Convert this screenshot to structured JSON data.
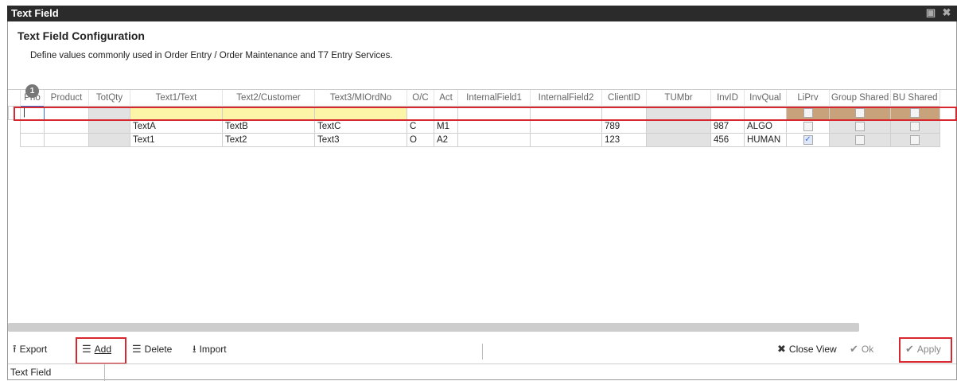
{
  "window": {
    "title": "Text Field",
    "icons": [
      "restore-icon",
      "close-icon"
    ]
  },
  "config": {
    "title": "Text Field Configuration",
    "description": "Define values commonly used in Order Entry / Order Maintenance and T7 Entry Services."
  },
  "grid": {
    "badge_count": "1",
    "columns": [
      "Prio",
      "Product",
      "TotQty",
      "Text1/Text",
      "Text2/Customer",
      "Text3/MIOrdNo",
      "O/C",
      "Act",
      "InternalField1",
      "InternalField2",
      "ClientID",
      "TUMbr",
      "InvID",
      "InvQual",
      "LiPrv",
      "Group Shared",
      "BU Shared"
    ],
    "new_row_cursor": "|",
    "rows": [
      {
        "prio": "",
        "product": "",
        "totqty": "",
        "text1": "TextA",
        "text2": "TextB",
        "text3": "TextC",
        "oc": "C",
        "act": "M1",
        "int1": "",
        "int2": "",
        "clientid": "789",
        "tumbr": "",
        "invid": "987",
        "invqual": "ALGO",
        "liprv": false,
        "group_shared": false,
        "bu_shared": false
      },
      {
        "prio": "",
        "product": "",
        "totqty": "",
        "text1": "Text1",
        "text2": "Text2",
        "text3": "Text3",
        "oc": "O",
        "act": "A2",
        "int1": "",
        "int2": "",
        "clientid": "123",
        "tumbr": "",
        "invid": "456",
        "invqual": "HUMAN",
        "liprv": true,
        "group_shared": false,
        "bu_shared": false
      }
    ]
  },
  "toolbar": {
    "export": "Export",
    "add": "Add",
    "delete": "Delete",
    "import": "Import",
    "close_view": "Close View",
    "ok": "Ok",
    "apply": "Apply"
  },
  "status": {
    "label": "Text Field"
  },
  "colors": {
    "highlight": "#d7272f",
    "required_cell": "#fcf5a8",
    "readonly_cell": "#e2e2e2",
    "titlebar": "#2b2b2b"
  }
}
